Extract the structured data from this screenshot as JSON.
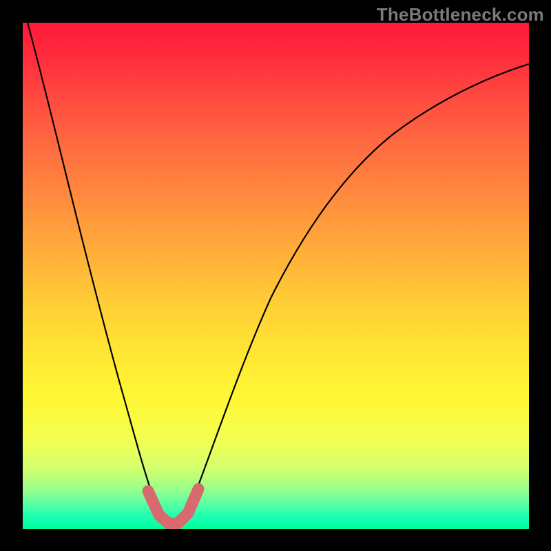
{
  "watermark": "TheBottleneck.com",
  "gradient": {
    "top": "#ff1a3a",
    "mid_upper": "#ff8a3e",
    "mid": "#ffe833",
    "lower": "#9cff8a",
    "bottom": "#00ff9a"
  },
  "chart_data": {
    "type": "line",
    "title": "",
    "xlabel": "",
    "ylabel": "",
    "xlim": [
      0,
      100
    ],
    "ylim": [
      0,
      100
    ],
    "grid": false,
    "legend": false,
    "series": [
      {
        "name": "bottleneck-curve",
        "x": [
          0,
          5,
          10,
          14,
          17,
          20,
          22,
          24,
          26,
          28,
          30,
          32,
          35,
          40,
          45,
          50,
          55,
          60,
          65,
          70,
          75,
          80,
          85,
          90,
          95,
          100
        ],
        "values": [
          100,
          83,
          64,
          49,
          37,
          25,
          15,
          6,
          1,
          0,
          1,
          5,
          14,
          28,
          39,
          48,
          55,
          61,
          66,
          70,
          73,
          76,
          78,
          80,
          81,
          82
        ]
      },
      {
        "name": "optimal-zone-marker",
        "x": [
          24,
          25,
          26,
          27,
          28,
          29,
          30,
          31,
          32,
          33
        ],
        "values": [
          6,
          3,
          1,
          0,
          0,
          0,
          1,
          2,
          4,
          7
        ]
      }
    ],
    "annotations": []
  },
  "curve_style": {
    "stroke": "#000000",
    "stroke_width": 2
  },
  "marker_style": {
    "stroke": "#d86a6f",
    "stroke_width": 16,
    "linecap": "round"
  }
}
